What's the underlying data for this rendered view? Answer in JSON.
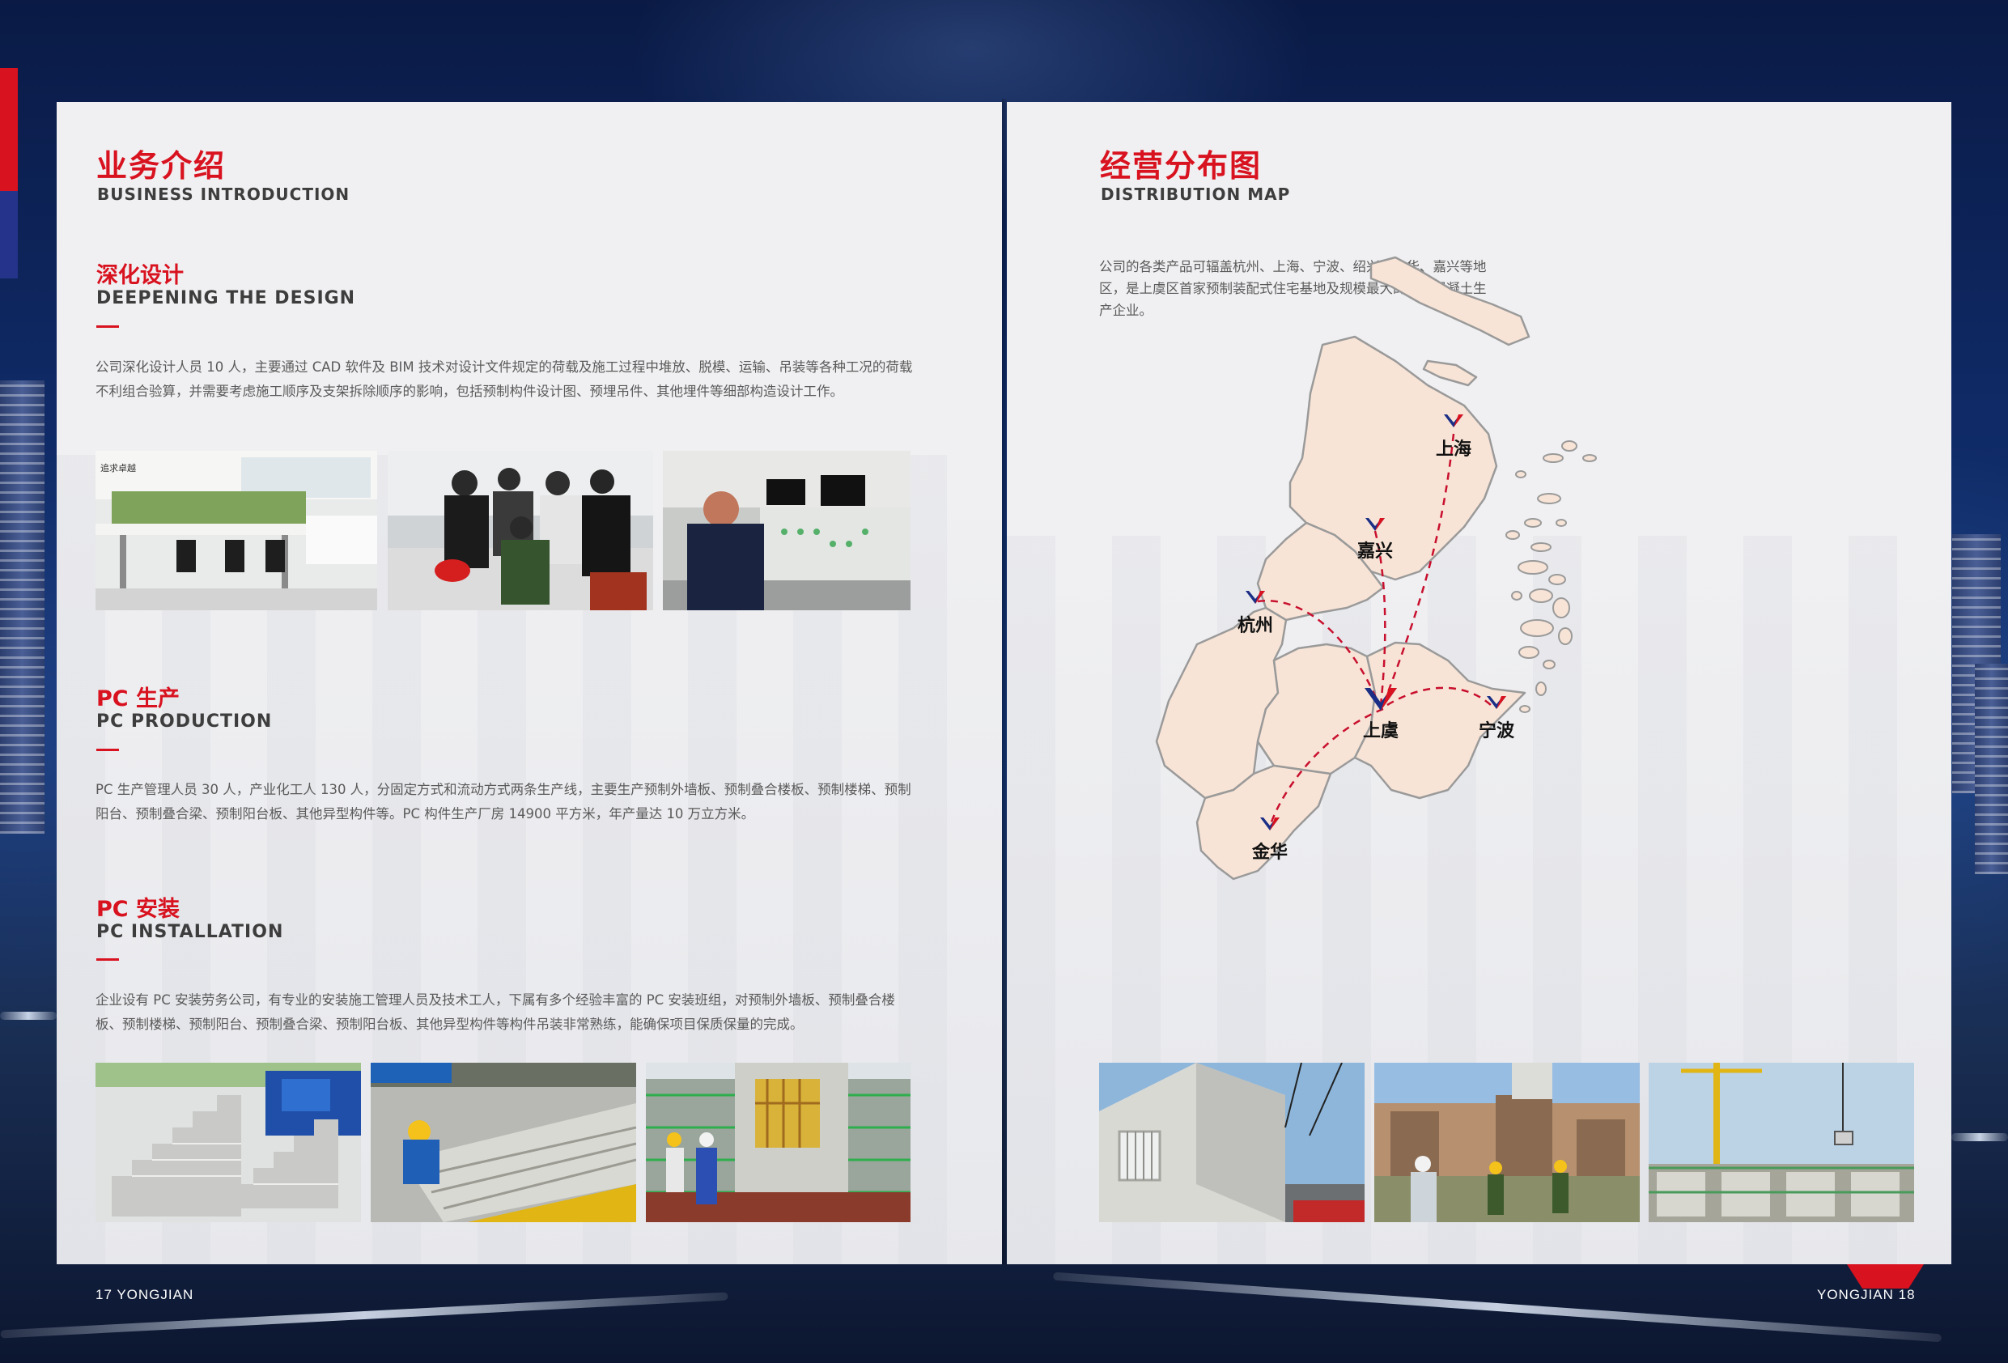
{
  "left_page": {
    "title": "业务介绍",
    "subtitle": "BUSINESS INTRODUCTION",
    "sections": [
      {
        "title": "深化设计",
        "subtitle": "DEEPENING THE DESIGN",
        "body": "公司深化设计人员 10 人，主要通过 CAD 软件及 BIM 技术对设计文件规定的荷载及施工过程中堆放、脱模、运输、吊装等各种工况的荷载不利组合验算，并需要考虑施工顺序及支架拆除顺序的影响，包括预制构件设计图、预埋吊件、其他埋件等细部构造设计工作。"
      },
      {
        "title": "PC 生产",
        "subtitle": "PC PRODUCTION",
        "body": "PC 生产管理人员 30 人，产业化工人 130 人，分固定方式和流动方式两条生产线，主要生产预制外墙板、预制叠合楼板、预制楼梯、预制阳台、预制叠合梁、预制阳台板、其他异型构件等。PC 构件生产厂房 14900 平方米，年产量达 10 万立方米。"
      },
      {
        "title": "PC 安装",
        "subtitle": "PC INSTALLATION",
        "body": "企业设有 PC 安装劳务公司，有专业的安装施工管理人员及技术工人，下属有多个经验丰富的 PC 安装班组，对预制外墙板、预制叠合楼板、预制楼梯、预制阳台、预制叠合梁、预制阳台板、其他异型构件等构件吊装非常熟练，能确保项目保质保量的完成。"
      }
    ],
    "office_sign": "追求卓越",
    "folio": "17  YONGJIAN"
  },
  "right_page": {
    "title": "经营分布图",
    "subtitle": "DISTRIBUTION MAP",
    "body": "公司的各类产品可辐盖杭州、上海、宁波、绍兴、金华、嘉兴等地区，是上虞区首家预制装配式住宅基地及规模最大的商品混凝土生产企业。",
    "map": {
      "cities": [
        "上海",
        "嘉兴",
        "杭州",
        "上虞",
        "宁波",
        "金华"
      ],
      "hub": "上虞",
      "region_color": "#f8e4d6",
      "border_color": "#9a9a9a",
      "route_color": "#c8102e"
    },
    "folio": "YONGJIAN  18"
  },
  "colors": {
    "accent_red": "#d8121f",
    "brand_blue": "#25338a",
    "page_bg": "#f0f0f2"
  }
}
